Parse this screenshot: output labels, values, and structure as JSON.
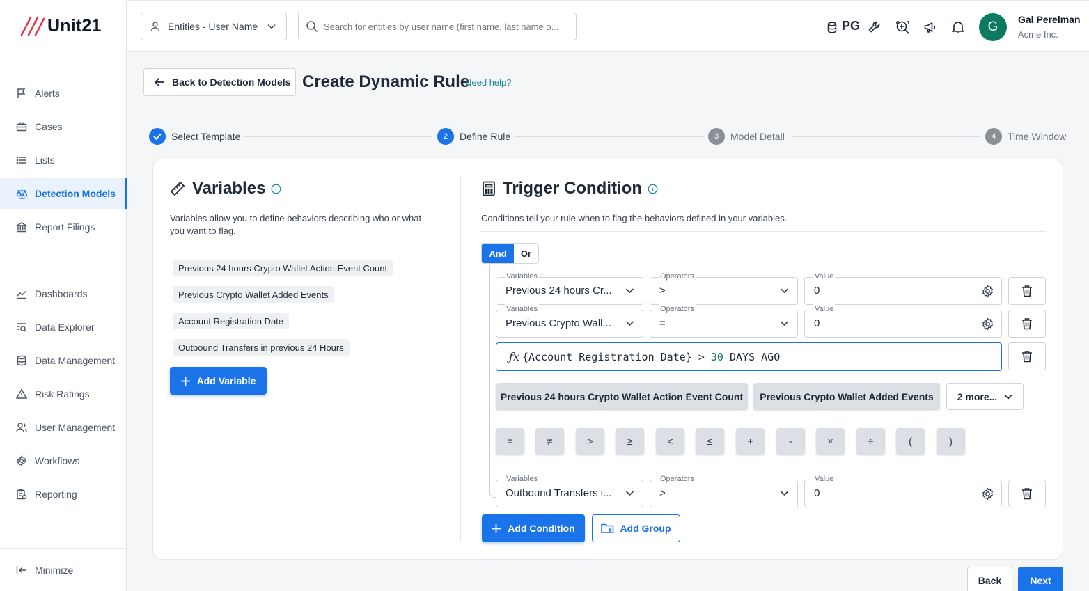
{
  "brand": {
    "name": "Unit21",
    "accent": "#1a73e8",
    "logo_slash_color": "#e0364f"
  },
  "sidebar": {
    "items": [
      {
        "label": "Alerts",
        "icon": "flag-icon"
      },
      {
        "label": "Cases",
        "icon": "briefcase-icon"
      },
      {
        "label": "Lists",
        "icon": "list-icon"
      },
      {
        "label": "Detection Models",
        "icon": "scale-icon",
        "active": true
      },
      {
        "label": "Report Filings",
        "icon": "bank-icon"
      },
      {
        "label": "Dashboards",
        "icon": "chart-line-icon"
      },
      {
        "label": "Data Explorer",
        "icon": "search-list-icon"
      },
      {
        "label": "Data Management",
        "icon": "database-icon"
      },
      {
        "label": "Risk Ratings",
        "icon": "warning-icon"
      },
      {
        "label": "User Management",
        "icon": "users-icon"
      },
      {
        "label": "Workflows",
        "icon": "gear-icon"
      },
      {
        "label": "Reporting",
        "icon": "report-icon"
      }
    ],
    "minimize_label": "Minimize"
  },
  "header": {
    "entity_select": "Entities - User Name",
    "search_placeholder": "Search for entities by user name (first name, last name o...",
    "db_label": "PG",
    "user_initial": "G",
    "user_name": "Gal Perelman",
    "user_org": "Acme Inc."
  },
  "page": {
    "back_label": "Back to Detection Models",
    "title": "Create Dynamic Rule",
    "help_link": "Need help?"
  },
  "stepper": [
    {
      "label": "Select Template",
      "status": "done"
    },
    {
      "label": "Define Rule",
      "number": "2",
      "status": "current"
    },
    {
      "label": "Model Detail",
      "number": "3",
      "status": "upcoming"
    },
    {
      "label": "Time Window",
      "number": "4",
      "status": "upcoming"
    }
  ],
  "variables": {
    "title": "Variables",
    "description": "Variables allow you to define behaviors describing who or what you want to flag.",
    "items": [
      "Previous 24 hours Crypto Wallet Action Event Count",
      "Previous Crypto Wallet Added Events",
      "Account Registration Date",
      "Outbound Transfers in previous 24 Hours"
    ],
    "add_label": "Add Variable"
  },
  "trigger": {
    "title": "Trigger Condition",
    "description": "Conditions tell your rule when to flag the behaviors defined in your variables.",
    "logic": {
      "and": "And",
      "or": "Or",
      "selected": "And"
    },
    "field_labels": {
      "variables": "Variables",
      "operators": "Operators",
      "value": "Value"
    },
    "conditions": [
      {
        "variable": "Previous 24 hours Cr...",
        "operator": ">",
        "value": "0"
      },
      {
        "variable": "Previous Crypto Wall...",
        "operator": "=",
        "value": "0"
      },
      {
        "variable": "Outbound Transfers i...",
        "operator": ">",
        "value": "0"
      }
    ],
    "formula": {
      "fx": "ƒx",
      "variable": "{Account Registration Date}",
      "op": " > ",
      "number": "30",
      "suffix": " DAYS AGO"
    },
    "variable_buttons": [
      "Previous 24 hours Crypto Wallet Action Event Count",
      "Previous Crypto Wallet Added Events"
    ],
    "more_label": "2 more...",
    "operators": [
      "=",
      "≠",
      ">",
      "≥",
      "<",
      "≤",
      "+",
      "-",
      "×",
      "÷",
      "(",
      ")"
    ],
    "add_condition_label": "Add Condition",
    "add_group_label": "Add Group"
  },
  "footer": {
    "back_label": "Back",
    "next_label": "Next"
  }
}
